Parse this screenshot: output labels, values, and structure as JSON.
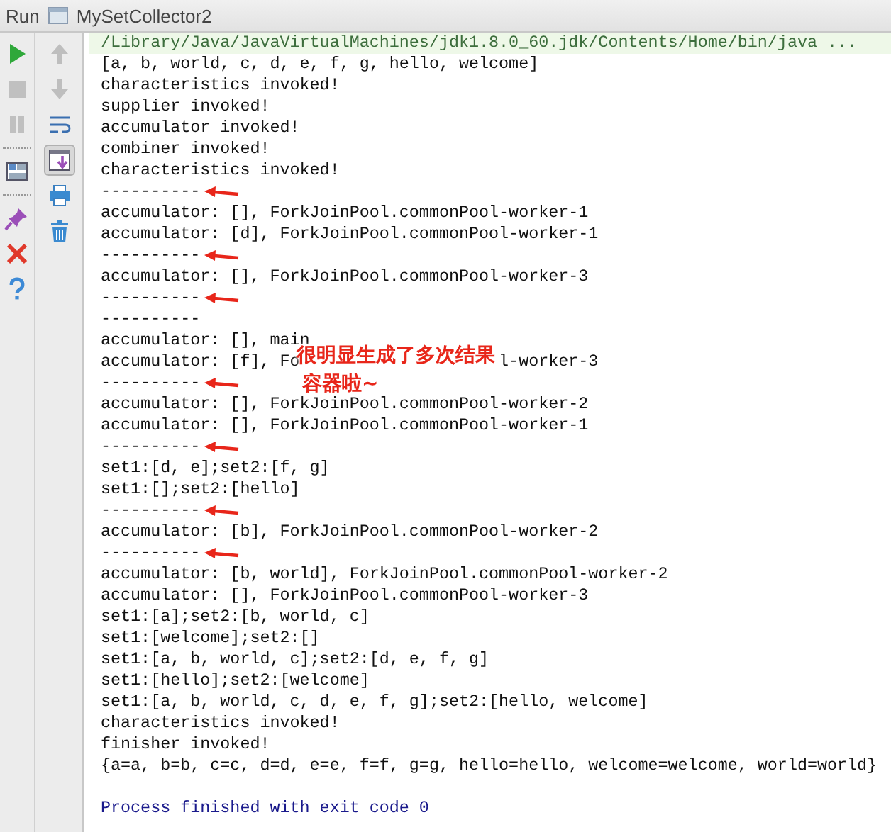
{
  "run_tab": {
    "label": "Run",
    "title": "MySetCollector2"
  },
  "tools_primary": [
    {
      "kind": "run",
      "disabled": false
    },
    {
      "kind": "stop",
      "disabled": true
    },
    {
      "kind": "pause",
      "disabled": true
    },
    {
      "kind": "layout",
      "disabled": false
    },
    {
      "kind": "pin",
      "disabled": false
    },
    {
      "kind": "close",
      "disabled": false
    },
    {
      "kind": "help",
      "disabled": false
    }
  ],
  "tools_secondary": [
    {
      "kind": "up",
      "disabled": true,
      "on": false
    },
    {
      "kind": "down",
      "disabled": true,
      "on": false
    },
    {
      "kind": "wrap",
      "disabled": false,
      "on": false
    },
    {
      "kind": "scroll",
      "disabled": false,
      "on": true
    },
    {
      "kind": "print",
      "disabled": false,
      "on": false
    },
    {
      "kind": "trash",
      "disabled": false,
      "on": false
    }
  ],
  "console": {
    "lines": [
      {
        "kind": "command",
        "text": "/Library/Java/JavaVirtualMachines/jdk1.8.0_60.jdk/Contents/Home/bin/java ..."
      },
      {
        "kind": "output",
        "text": "[a, b, world, c, d, e, f, g, hello, welcome]"
      },
      {
        "kind": "output",
        "text": "characteristics invoked!"
      },
      {
        "kind": "output",
        "text": "supplier invoked!"
      },
      {
        "kind": "output",
        "text": "accumulator invoked!"
      },
      {
        "kind": "output",
        "text": "combiner invoked!"
      },
      {
        "kind": "output",
        "text": "characteristics invoked!"
      },
      {
        "kind": "separator",
        "text": "----------",
        "arrow": true
      },
      {
        "kind": "output",
        "text": "accumulator: [], ForkJoinPool.commonPool-worker-1"
      },
      {
        "kind": "output",
        "text": "accumulator: [d], ForkJoinPool.commonPool-worker-1"
      },
      {
        "kind": "separator",
        "text": "----------",
        "arrow": true
      },
      {
        "kind": "output",
        "text": "accumulator: [], ForkJoinPool.commonPool-worker-3"
      },
      {
        "kind": "separator",
        "text": "----------",
        "arrow": true
      },
      {
        "kind": "separator",
        "text": "----------",
        "arrow": false
      },
      {
        "kind": "output",
        "text": "accumulator: [], main"
      },
      {
        "kind": "covered",
        "text": "accumulator: [f], Fo",
        "text_after": "l-worker-3"
      },
      {
        "kind": "separator",
        "text": "----------",
        "arrow": true
      },
      {
        "kind": "output",
        "text": "accumulator: [], ForkJoinPool.commonPool-worker-2"
      },
      {
        "kind": "output",
        "text": "accumulator: [], ForkJoinPool.commonPool-worker-1"
      },
      {
        "kind": "separator",
        "text": "----------",
        "arrow": true
      },
      {
        "kind": "output",
        "text": "set1:[d, e];set2:[f, g]"
      },
      {
        "kind": "output",
        "text": "set1:[];set2:[hello]"
      },
      {
        "kind": "separator",
        "text": "----------",
        "arrow": true
      },
      {
        "kind": "output",
        "text": "accumulator: [b], ForkJoinPool.commonPool-worker-2"
      },
      {
        "kind": "separator",
        "text": "----------",
        "arrow": true
      },
      {
        "kind": "output",
        "text": "accumulator: [b, world], ForkJoinPool.commonPool-worker-2"
      },
      {
        "kind": "output",
        "text": "accumulator: [], ForkJoinPool.commonPool-worker-3"
      },
      {
        "kind": "output",
        "text": "set1:[a];set2:[b, world, c]"
      },
      {
        "kind": "output",
        "text": "set1:[welcome];set2:[]"
      },
      {
        "kind": "output",
        "text": "set1:[a, b, world, c];set2:[d, e, f, g]"
      },
      {
        "kind": "output",
        "text": "set1:[hello];set2:[welcome]"
      },
      {
        "kind": "output",
        "text": "set1:[a, b, world, c, d, e, f, g];set2:[hello, welcome]"
      },
      {
        "kind": "output",
        "text": "characteristics invoked!"
      },
      {
        "kind": "output",
        "text": "finisher invoked!"
      },
      {
        "kind": "output",
        "text": "{a=a, b=b, c=c, d=d, e=e, f=f, g=g, hello=hello, welcome=welcome, world=world}"
      },
      {
        "kind": "blank"
      },
      {
        "kind": "exit",
        "text": "Process finished with exit code 0"
      }
    ],
    "annotation": {
      "lines": [
        "很明显生成了多次结果",
        "容器啦~"
      ]
    }
  }
}
